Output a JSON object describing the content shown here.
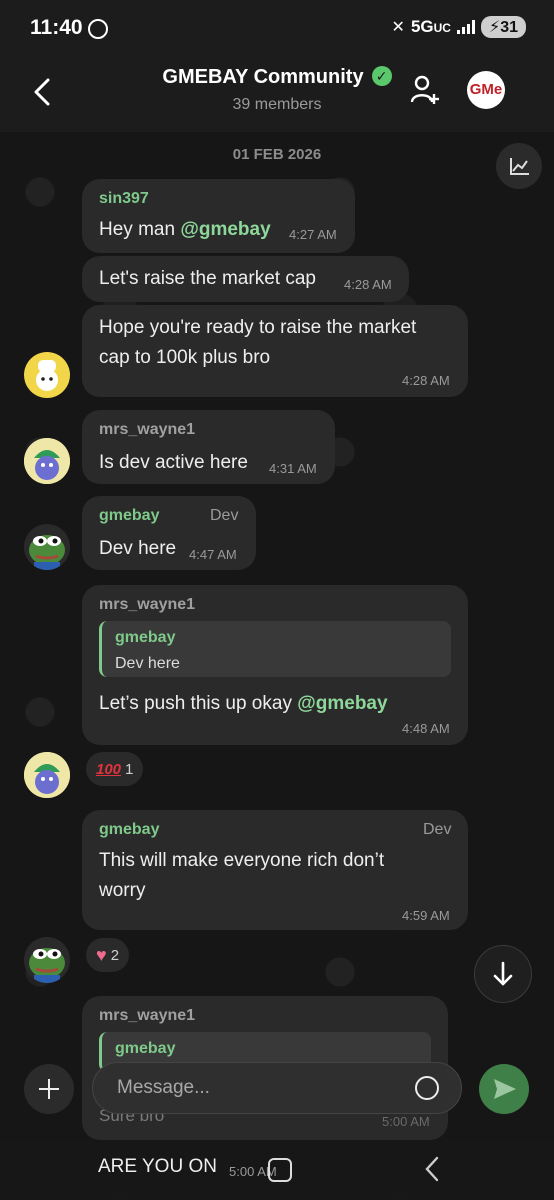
{
  "status_bar": {
    "time": "11:40",
    "network": "5G",
    "network_suffix": "UC",
    "battery": "31"
  },
  "header": {
    "title": "GMEBAY Community",
    "members": "39 members",
    "avatar_text": "GMe"
  },
  "date_separator": "01 FEB 2026",
  "messages": [
    {
      "sender": "sin397",
      "text_prefix": "Hey man ",
      "mention": "@gmebay",
      "time": "4:27 AM"
    },
    {
      "text": "Let's raise the market cap",
      "time": "4:28 AM"
    },
    {
      "text_line1": "Hope you're ready to raise the market",
      "text_line2": "cap to 100k plus bro",
      "time": "4:28 AM"
    },
    {
      "sender": "mrs_wayne1",
      "text": "Is dev active here",
      "time": "4:31 AM"
    },
    {
      "sender": "gmebay",
      "role": "Dev",
      "text": "Dev here",
      "time": "4:47 AM"
    },
    {
      "sender": "mrs_wayne1",
      "quote_name": "gmebay",
      "quote_text": "Dev here",
      "text_prefix": "Let’s push this up okay ",
      "mention": "@gmebay",
      "time": "4:48 AM"
    },
    {
      "sender": "gmebay",
      "role": "Dev",
      "text_line1": "This will make everyone rich don’t",
      "text_line2": "worry",
      "time": "4:59 AM"
    },
    {
      "sender": "mrs_wayne1",
      "quote_name": "gmebay",
      "text": "Sure bro",
      "time": "5:00 AM"
    },
    {
      "text": "ARE YOU ON",
      "time": "5:00 AM"
    }
  ],
  "reactions": [
    {
      "emoji": "100",
      "count": "1"
    },
    {
      "emoji": "heart",
      "count": "2"
    }
  ],
  "composer": {
    "placeholder": "Message..."
  },
  "colors": {
    "accent_green": "#7fc98a",
    "bubble_bg": "#2a2a2a",
    "send_button": "#3f7f48"
  }
}
